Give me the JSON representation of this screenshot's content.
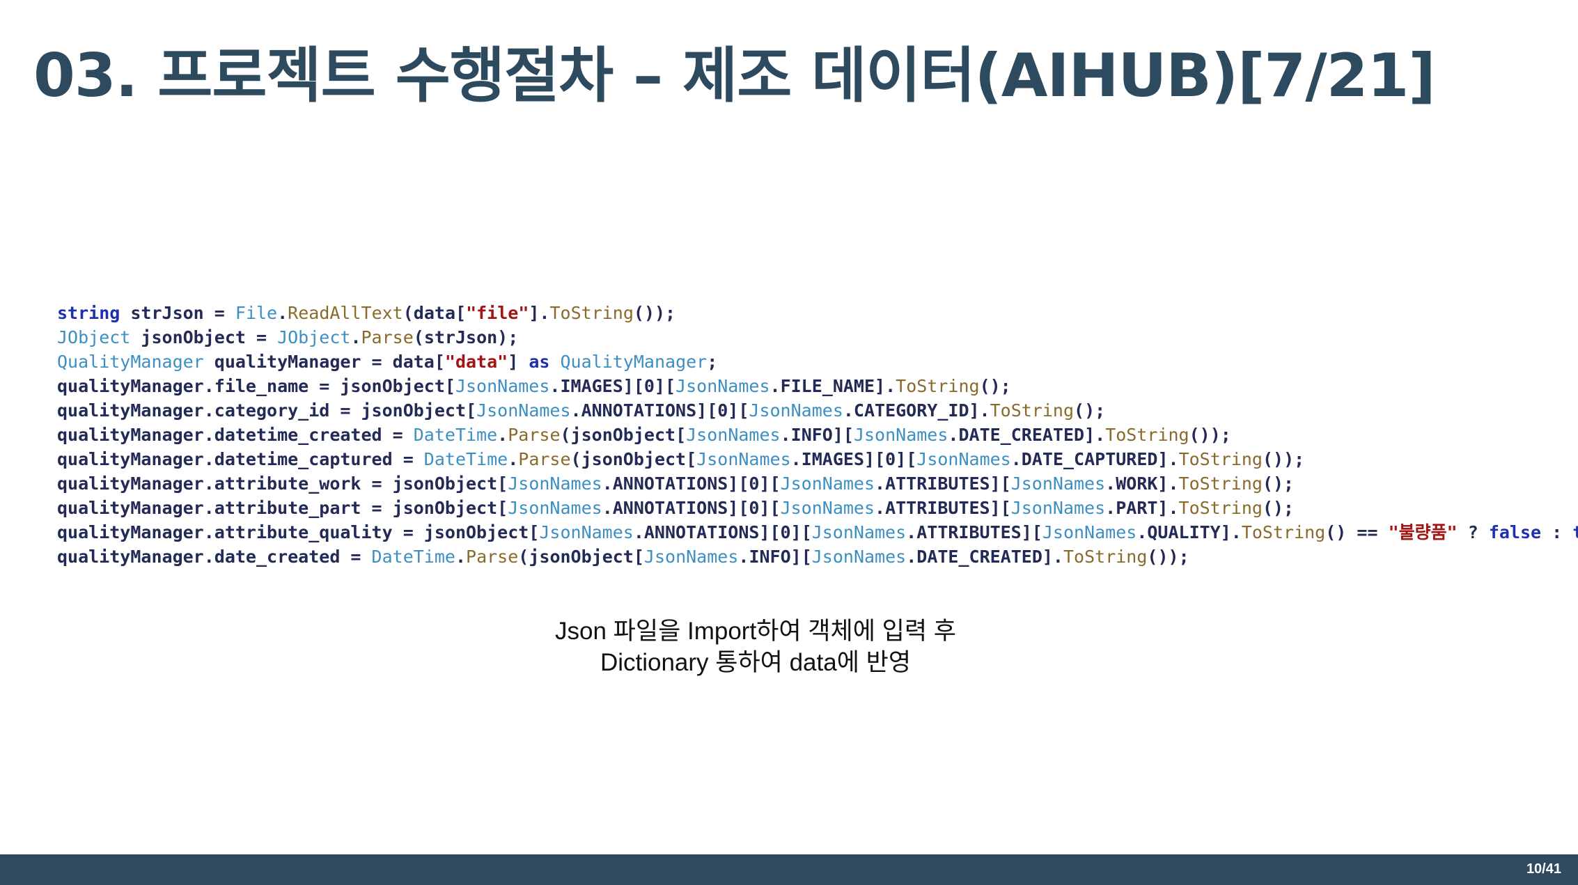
{
  "slide": {
    "title": "03. 프로젝트 수행절차 – 제조 데이터(AIHUB)[7/21]",
    "caption_line1": "Json 파일을 Import하여 객체에 입력 후",
    "caption_line2": "Dictionary 통하여 data에 반영",
    "page_number": "10/41"
  },
  "code": {
    "lines": [
      [
        [
          "kw",
          "string"
        ],
        [
          "id",
          " strJson = "
        ],
        [
          "ty",
          "File"
        ],
        [
          "id",
          "."
        ],
        [
          "me",
          "ReadAllText"
        ],
        [
          "id",
          "(data["
        ],
        [
          "st",
          "\"file\""
        ],
        [
          "id",
          "]."
        ],
        [
          "me",
          "ToString"
        ],
        [
          "id",
          "());"
        ]
      ],
      [
        [
          "ty",
          "JObject"
        ],
        [
          "id",
          " jsonObject = "
        ],
        [
          "ty",
          "JObject"
        ],
        [
          "id",
          "."
        ],
        [
          "me",
          "Parse"
        ],
        [
          "id",
          "(strJson);"
        ]
      ],
      [
        [
          "ty",
          "QualityManager"
        ],
        [
          "id",
          " qualityManager = data["
        ],
        [
          "st",
          "\"data\""
        ],
        [
          "id",
          "] "
        ],
        [
          "kw",
          "as"
        ],
        [
          "id",
          " "
        ],
        [
          "ty",
          "QualityManager"
        ],
        [
          "id",
          ";"
        ]
      ],
      [
        [
          "id",
          "qualityManager.file_name = jsonObject["
        ],
        [
          "ty",
          "JsonNames"
        ],
        [
          "id",
          ".IMAGES][0]["
        ],
        [
          "ty",
          "JsonNames"
        ],
        [
          "id",
          ".FILE_NAME]."
        ],
        [
          "me",
          "ToString"
        ],
        [
          "id",
          "();"
        ]
      ],
      [
        [
          "id",
          "qualityManager.category_id = jsonObject["
        ],
        [
          "ty",
          "JsonNames"
        ],
        [
          "id",
          ".ANNOTATIONS][0]["
        ],
        [
          "ty",
          "JsonNames"
        ],
        [
          "id",
          ".CATEGORY_ID]."
        ],
        [
          "me",
          "ToString"
        ],
        [
          "id",
          "();"
        ]
      ],
      [
        [
          "id",
          "qualityManager.datetime_created = "
        ],
        [
          "ty",
          "DateTime"
        ],
        [
          "id",
          "."
        ],
        [
          "me",
          "Parse"
        ],
        [
          "id",
          "(jsonObject["
        ],
        [
          "ty",
          "JsonNames"
        ],
        [
          "id",
          ".INFO]["
        ],
        [
          "ty",
          "JsonNames"
        ],
        [
          "id",
          ".DATE_CREATED]."
        ],
        [
          "me",
          "ToString"
        ],
        [
          "id",
          "());"
        ]
      ],
      [
        [
          "id",
          "qualityManager.datetime_captured = "
        ],
        [
          "ty",
          "DateTime"
        ],
        [
          "id",
          "."
        ],
        [
          "me",
          "Parse"
        ],
        [
          "id",
          "(jsonObject["
        ],
        [
          "ty",
          "JsonNames"
        ],
        [
          "id",
          ".IMAGES][0]["
        ],
        [
          "ty",
          "JsonNames"
        ],
        [
          "id",
          ".DATE_CAPTURED]."
        ],
        [
          "me",
          "ToString"
        ],
        [
          "id",
          "());"
        ]
      ],
      [
        [
          "id",
          "qualityManager.attribute_work = jsonObject["
        ],
        [
          "ty",
          "JsonNames"
        ],
        [
          "id",
          ".ANNOTATIONS][0]["
        ],
        [
          "ty",
          "JsonNames"
        ],
        [
          "id",
          ".ATTRIBUTES]["
        ],
        [
          "ty",
          "JsonNames"
        ],
        [
          "id",
          ".WORK]."
        ],
        [
          "me",
          "ToString"
        ],
        [
          "id",
          "();"
        ]
      ],
      [
        [
          "id",
          "qualityManager.attribute_part = jsonObject["
        ],
        [
          "ty",
          "JsonNames"
        ],
        [
          "id",
          ".ANNOTATIONS][0]["
        ],
        [
          "ty",
          "JsonNames"
        ],
        [
          "id",
          ".ATTRIBUTES]["
        ],
        [
          "ty",
          "JsonNames"
        ],
        [
          "id",
          ".PART]."
        ],
        [
          "me",
          "ToString"
        ],
        [
          "id",
          "();"
        ]
      ],
      [
        [
          "id",
          "qualityManager.attribute_quality = jsonObject["
        ],
        [
          "ty",
          "JsonNames"
        ],
        [
          "id",
          ".ANNOTATIONS][0]["
        ],
        [
          "ty",
          "JsonNames"
        ],
        [
          "id",
          ".ATTRIBUTES]["
        ],
        [
          "ty",
          "JsonNames"
        ],
        [
          "id",
          ".QUALITY]."
        ],
        [
          "me",
          "ToString"
        ],
        [
          "id",
          "() == "
        ],
        [
          "st",
          "\"불량품\""
        ],
        [
          "id",
          " ? "
        ],
        [
          "kw",
          "false"
        ],
        [
          "id",
          " : "
        ],
        [
          "kw",
          "true"
        ],
        [
          "id",
          ";"
        ]
      ],
      [
        [
          "id",
          "qualityManager.date_created = "
        ],
        [
          "ty",
          "DateTime"
        ],
        [
          "id",
          "."
        ],
        [
          "me",
          "Parse"
        ],
        [
          "id",
          "(jsonObject["
        ],
        [
          "ty",
          "JsonNames"
        ],
        [
          "id",
          ".INFO]["
        ],
        [
          "ty",
          "JsonNames"
        ],
        [
          "id",
          ".DATE_CREATED]."
        ],
        [
          "me",
          "ToString"
        ],
        [
          "id",
          "());"
        ]
      ]
    ]
  },
  "colors": {
    "title": "#2e4a5f",
    "footer_bar": "#2e4a5f",
    "keyword": "#1e2fb0",
    "type": "#3d8fc2",
    "method": "#8a6a2a",
    "string": "#a31515"
  }
}
